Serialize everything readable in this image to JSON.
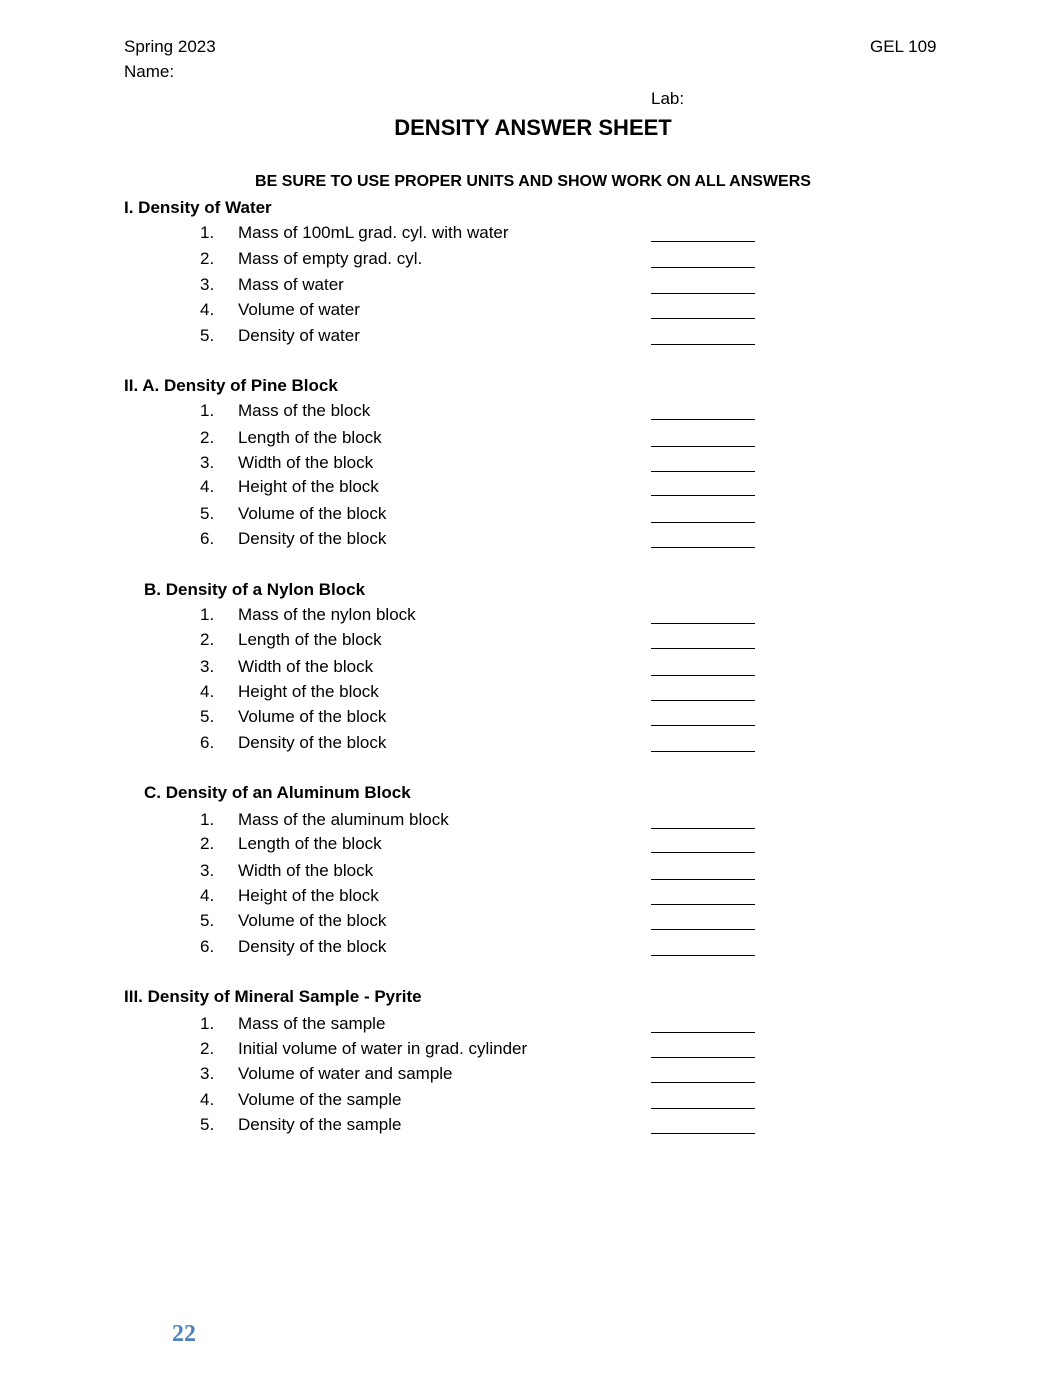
{
  "header": {
    "semester": "Spring 2023",
    "course": "GEL 109",
    "name_label": "Name:",
    "lab_label": "Lab:"
  },
  "title": "DENSITY ANSWER SHEET",
  "instructions": "BE SURE TO USE PROPER UNITS AND SHOW WORK ON ALL ANSWERS",
  "sections": [
    {
      "heading": "I. Density of Water",
      "items": [
        {
          "num": "1.",
          "label": "Mass of 100mL grad. cyl. with water",
          "answer": ""
        },
        {
          "num": "2.",
          "label": "Mass of empty grad. cyl.",
          "answer": ""
        },
        {
          "num": "3.",
          "label": "Mass of water",
          "answer": ""
        },
        {
          "num": "4.",
          "label": "Volume of water",
          "answer": ""
        },
        {
          "num": "5.",
          "label": "Density of water",
          "answer": ""
        }
      ]
    },
    {
      "heading": "II. A. Density of Pine Block",
      "items": [
        {
          "num": "1.",
          "label": "Mass of the block",
          "answer": ""
        },
        {
          "num": "2.",
          "label": "Length of the block",
          "answer": ""
        },
        {
          "num": "3.",
          "label": "Width of the block",
          "answer": ""
        },
        {
          "num": "4.",
          "label": "Height of the block",
          "answer": ""
        },
        {
          "num": "5.",
          "label": "Volume of the block",
          "answer": ""
        },
        {
          "num": "6.",
          "label": "Density of the block",
          "answer": ""
        }
      ]
    },
    {
      "heading": "B. Density of a Nylon Block",
      "items": [
        {
          "num": "1.",
          "label": "Mass of the nylon block",
          "answer": ""
        },
        {
          "num": "2.",
          "label": "Length of the block",
          "answer": ""
        },
        {
          "num": "3.",
          "label": "Width of the block",
          "answer": ""
        },
        {
          "num": "4.",
          "label": "Height of the block",
          "answer": ""
        },
        {
          "num": "5.",
          "label": "Volume of the block",
          "answer": ""
        },
        {
          "num": "6.",
          "label": "Density of the block",
          "answer": ""
        }
      ]
    },
    {
      "heading": "C. Density of an Aluminum Block",
      "items": [
        {
          "num": "1.",
          "label": "Mass of the aluminum block",
          "answer": ""
        },
        {
          "num": "2.",
          "label": "Length of the block",
          "answer": ""
        },
        {
          "num": "3.",
          "label": "Width of the block",
          "answer": ""
        },
        {
          "num": "4.",
          "label": "Height of the block",
          "answer": ""
        },
        {
          "num": "5.",
          "label": "Volume of the block",
          "answer": ""
        },
        {
          "num": "6.",
          "label": "Density of the block",
          "answer": ""
        }
      ]
    },
    {
      "heading": "III. Density of Mineral Sample - Pyrite",
      "items": [
        {
          "num": "1.",
          "label": "Mass of the sample",
          "answer": ""
        },
        {
          "num": "2.",
          "label": "Initial volume of water in grad. cylinder",
          "answer": ""
        },
        {
          "num": "3.",
          "label": "Volume of water and sample",
          "answer": ""
        },
        {
          "num": "4.",
          "label": "Volume of the sample",
          "answer": ""
        },
        {
          "num": "5.",
          "label": "Density of the sample",
          "answer": ""
        }
      ]
    }
  ],
  "footer": {
    "page_number": "22",
    "page_number_color": "#4f81bd"
  }
}
